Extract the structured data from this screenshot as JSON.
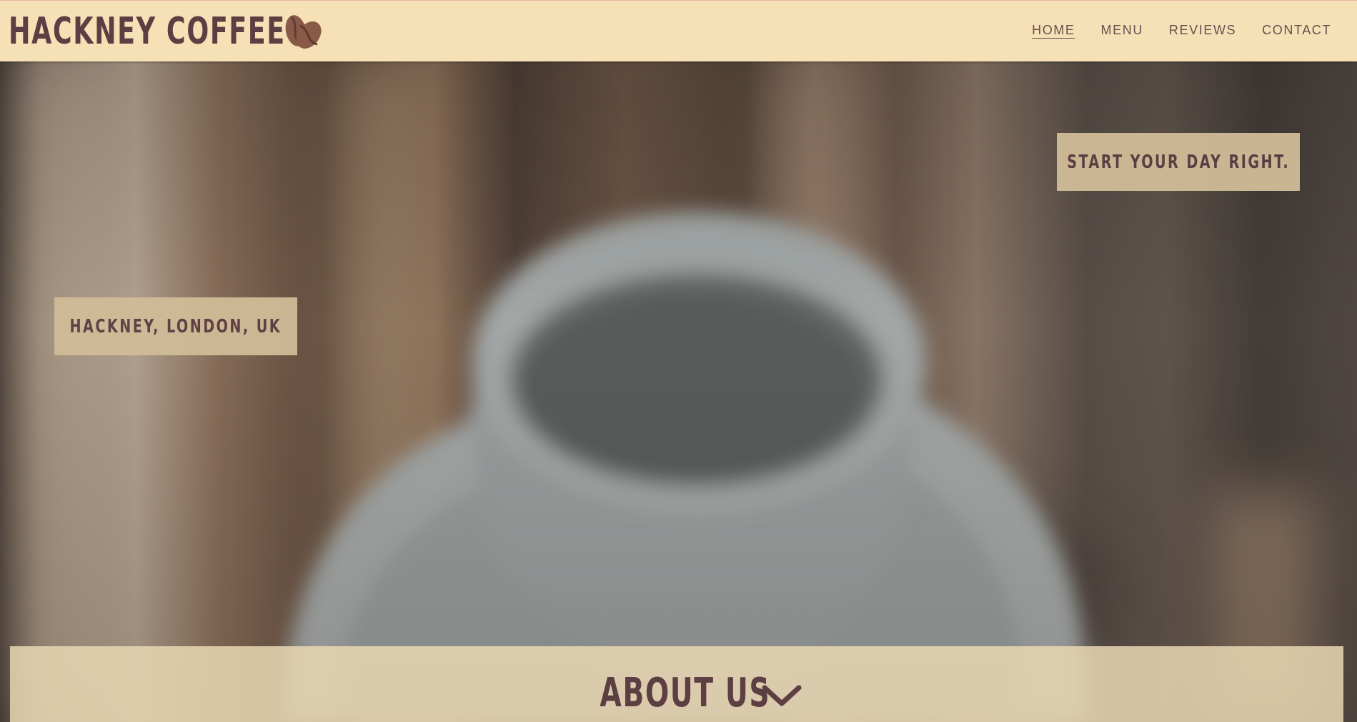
{
  "header": {
    "brand_name": "HACKNEY COFFEE",
    "brand_icon": "coffee-beans-icon",
    "nav": [
      {
        "label": "HOME",
        "active": true
      },
      {
        "label": "MENU",
        "active": false
      },
      {
        "label": "REVIEWS",
        "active": false
      },
      {
        "label": "CONTACT",
        "active": false
      }
    ]
  },
  "hero": {
    "tagline": "START YOUR DAY RIGHT.",
    "location": "HACKNEY, LONDON, UK",
    "background_image": "blurred-coffee-cup-on-saucer"
  },
  "about": {
    "title": "ABOUT US",
    "icon": "chevron-down-icon"
  },
  "colors": {
    "header_bg": "#f6e1b6",
    "brand_text": "#5d3e43",
    "nav_text": "#6a4e4f",
    "tag_bg": "#d1bc98",
    "about_bg": "#e8d6b2"
  }
}
